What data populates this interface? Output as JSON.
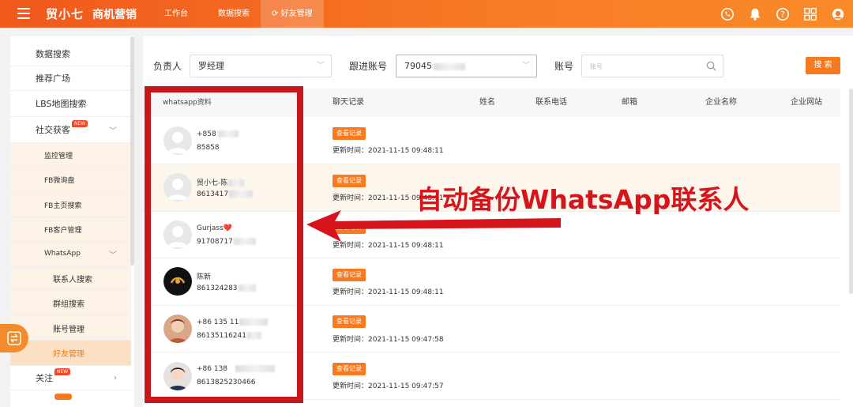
{
  "header": {
    "brand": "贸小七",
    "product": "商机营销",
    "tabs": [
      "工作台",
      "数据搜索",
      "好友管理"
    ],
    "active_tab_icon": "refresh-icon"
  },
  "sidebar": {
    "items": [
      "数据搜索",
      "推荐广场",
      "LBS地图搜索",
      "社交获客"
    ],
    "social_new_badge": "NEW",
    "social_sub": [
      "监控管理",
      "FB微询盘",
      "FB主页搜索",
      "FB客户管理",
      "WhatsApp"
    ],
    "whatsapp_sub": [
      "联系人搜索",
      "群组搜索",
      "账号管理",
      "好友管理"
    ],
    "follow": "关注",
    "follow_new_badge": "NEW"
  },
  "filters": {
    "owner_label": "负责人",
    "owner_value": "罗经理",
    "follow_account_label": "跟进账号",
    "follow_account_value": "79045",
    "account_label": "账号",
    "account_placeholder": "账号",
    "search_button": "搜 索"
  },
  "table": {
    "columns": [
      "whatsapp资料",
      "聊天记录",
      "姓名",
      "联系电话",
      "邮箱",
      "企业名称",
      "企业网站"
    ],
    "view_button": "查看记录",
    "update_prefix": "更新时间：",
    "rows": [
      {
        "name": "+858",
        "phone": "85858",
        "updated": "2021-11-15 09:48:11"
      },
      {
        "name": "贸小七-陈",
        "phone": "8613417",
        "updated": "2021-11-15 09:48:11"
      },
      {
        "name": "Gurjass❤️",
        "phone": "91708717",
        "updated": "2021-11-15 09:48:11"
      },
      {
        "name": "陈新",
        "phone": "861324283",
        "updated": "2021-11-15 09:48:11"
      },
      {
        "name": "+86 135 11",
        "phone": "86135116241",
        "updated": "2021-11-15 09:47:58"
      },
      {
        "name": "+86 138",
        "phone": "8613825230466",
        "updated": "2021-11-15 09:47:57"
      }
    ]
  },
  "annotation": {
    "text": "自动备份WhatsApp联系人"
  },
  "colors": {
    "brand_orange": "#f77a20",
    "annotation_red": "#d6141c"
  }
}
